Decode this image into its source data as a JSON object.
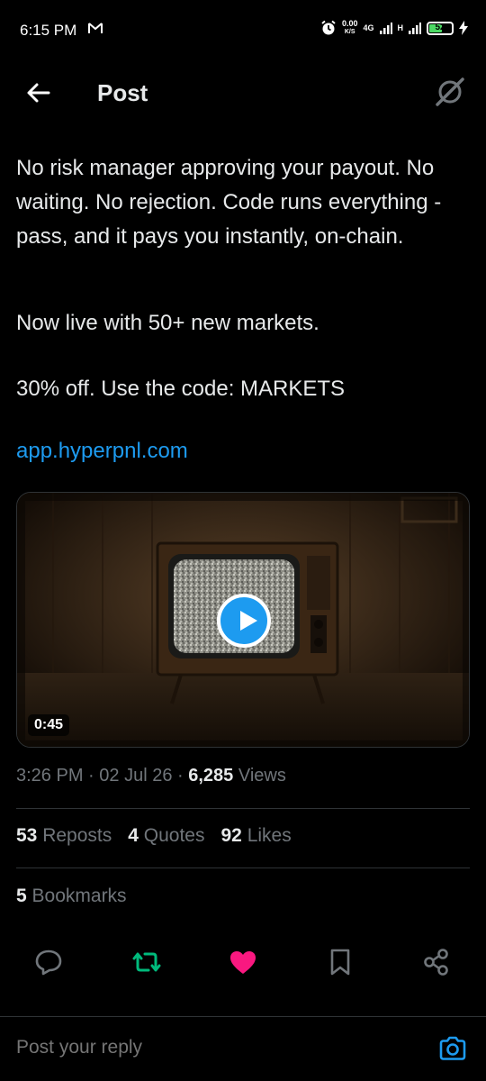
{
  "status_bar": {
    "time": "6:15 PM",
    "speed_value": "0.00",
    "speed_unit": "K/S",
    "network_4g": "4G",
    "network_h": "H",
    "battery": "52"
  },
  "header": {
    "title": "Post"
  },
  "post": {
    "para1": "No risk manager approving your payout. No waiting. No rejection. Code runs everything - pass, and it pays you instantly, on-chain.",
    "para2": "Now live with 50+ new markets.",
    "para3": "30% off. Use the code: MARKETS",
    "link": "app.hyperpnl.com",
    "video_duration": "0:45"
  },
  "meta": {
    "time": "3:26 PM",
    "date": "02 Jul 26",
    "views_count": "6,285",
    "views_label": "Views"
  },
  "stats": {
    "reposts_count": "53",
    "reposts_label": "Reposts",
    "quotes_count": "4",
    "quotes_label": "Quotes",
    "likes_count": "92",
    "likes_label": "Likes",
    "bookmarks_count": "5",
    "bookmarks_label": "Bookmarks"
  },
  "actions": [
    {
      "icon": "reply-icon"
    },
    {
      "icon": "repost-icon"
    },
    {
      "icon": "like-icon"
    },
    {
      "icon": "bookmark-icon"
    },
    {
      "icon": "share-icon"
    }
  ],
  "reply": {
    "placeholder": "Post your reply"
  },
  "colors": {
    "accent": "#1d9bf0",
    "repost_active": "#00ba7c",
    "like_active": "#f91880",
    "muted": "#71767b"
  }
}
